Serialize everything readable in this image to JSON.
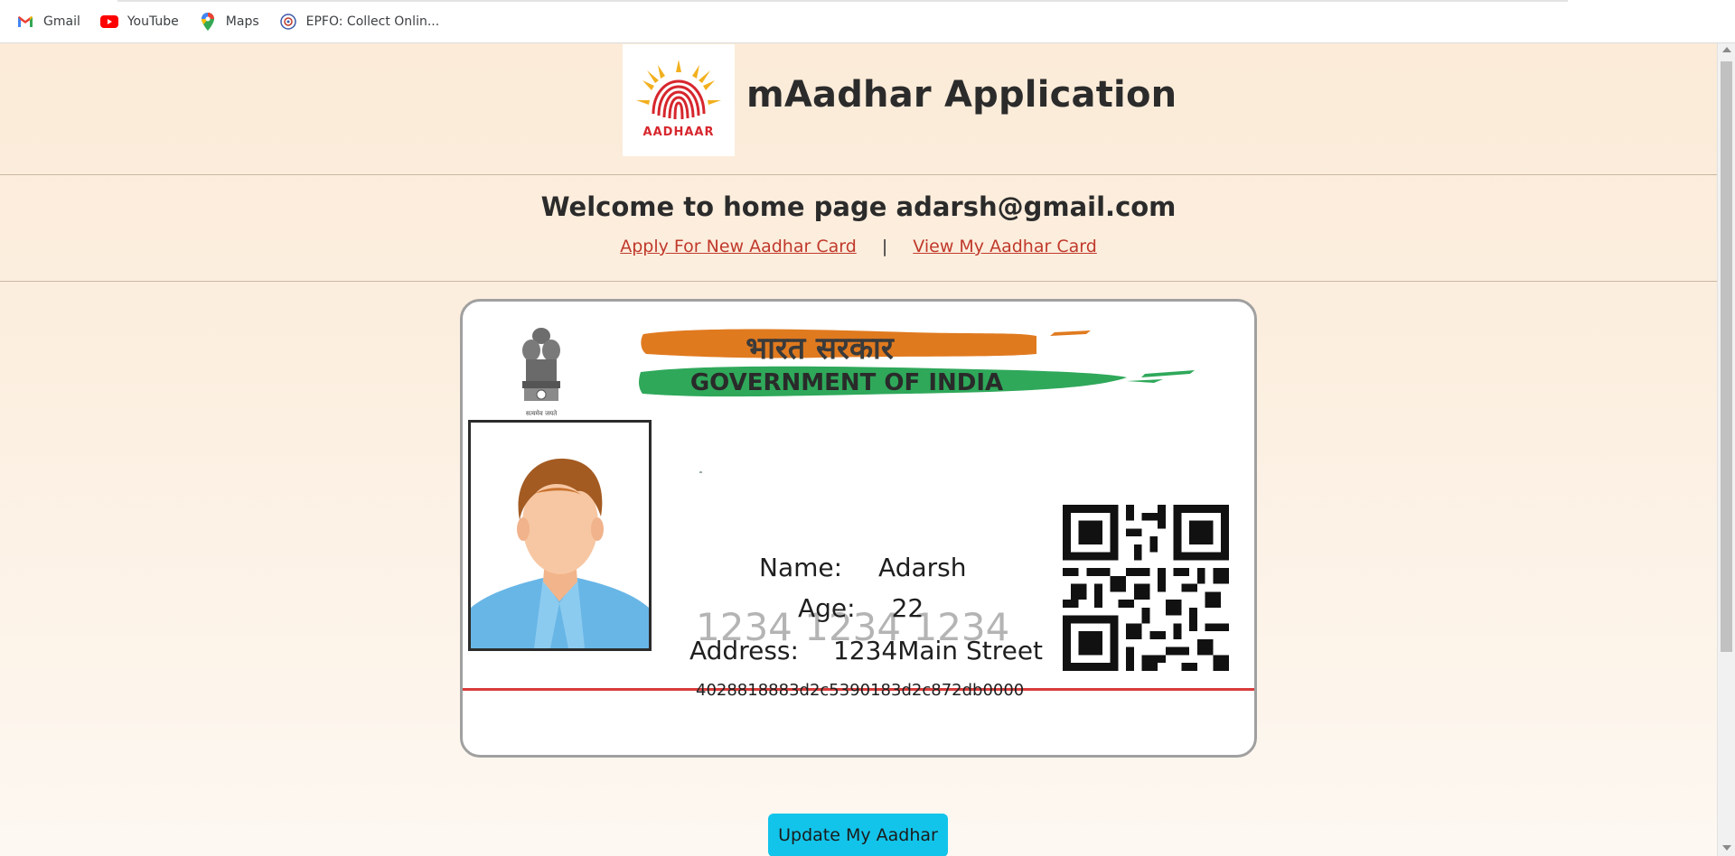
{
  "bookmarks": [
    {
      "label": "Gmail",
      "icon": "gmail-icon"
    },
    {
      "label": "YouTube",
      "icon": "youtube-icon"
    },
    {
      "label": "Maps",
      "icon": "maps-icon"
    },
    {
      "label": "EPFO: Collect Onlin...",
      "icon": "epfo-icon"
    }
  ],
  "header": {
    "title": "mAadhar Application",
    "logo_text": "AADHAAR"
  },
  "welcome": {
    "text": "Welcome to home page adarsh@gmail.com",
    "links": {
      "apply": "Apply For New Aadhar Card",
      "separator": "|",
      "view": "View My Aadhar Card"
    }
  },
  "card": {
    "banner_hindi": "भारत सरकार",
    "banner_english": "GOVERNMENT OF INDIA",
    "emblem_caption": "सत्यमेव जयते",
    "name_label": "Name:",
    "name_value": "Adarsh",
    "age_label": "Age:",
    "age_value": "22",
    "address_label": "Address:",
    "address_value": "1234Main Street",
    "watermark_number": "1234 1234 1234",
    "uid_code": "4028818883d2c5390183d2c872db0000"
  },
  "actions": {
    "update_label": "Update My Aadhar"
  },
  "colors": {
    "page_bg": "#fbebd8",
    "link": "#c0392b",
    "button": "#12c4ea",
    "saffron": "#e07a1f",
    "green": "#2fa85a"
  }
}
